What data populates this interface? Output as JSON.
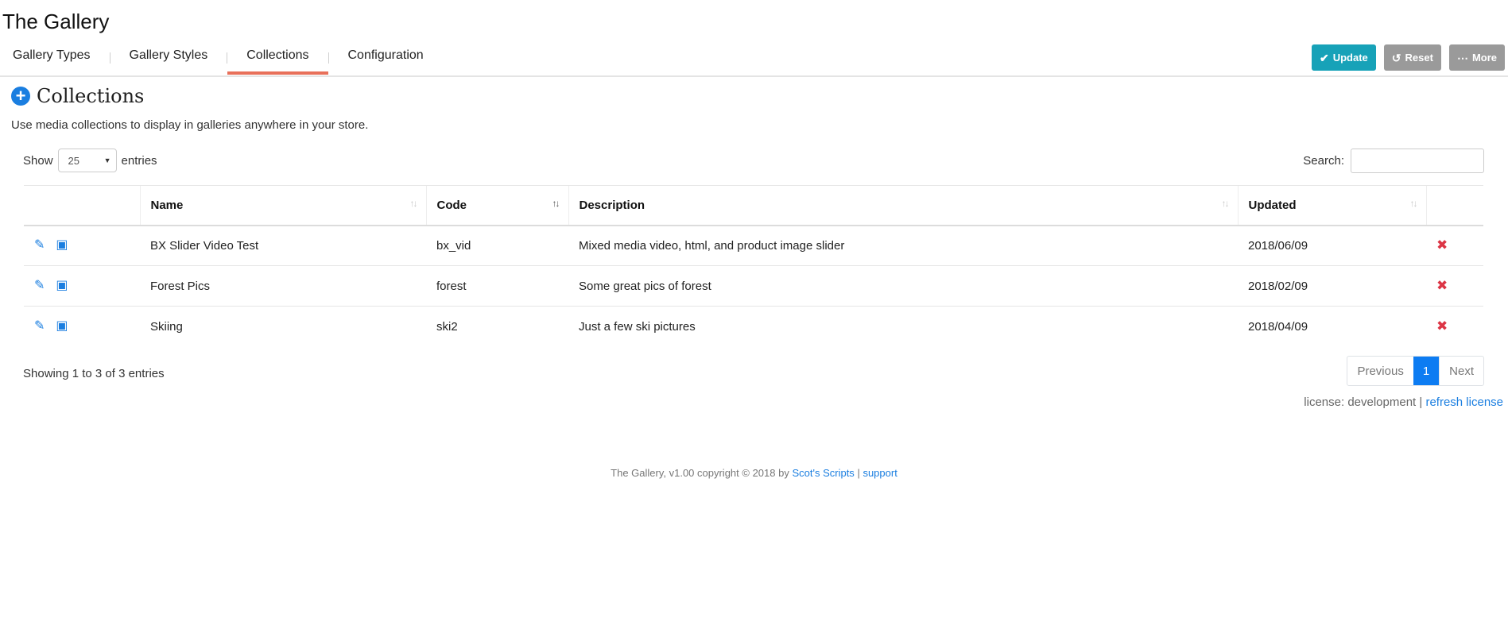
{
  "app": {
    "title": "The Gallery"
  },
  "nav": {
    "tabs": [
      {
        "label": "Gallery Types"
      },
      {
        "label": "Gallery Styles"
      },
      {
        "label": "Collections"
      },
      {
        "label": "Configuration"
      }
    ],
    "active_tab": "Collections"
  },
  "toolbar": {
    "update_label": "Update",
    "reset_label": "Reset",
    "more_label": "More"
  },
  "section": {
    "title": "Collections",
    "description": "Use media collections to display in galleries anywhere in your store."
  },
  "table_controls": {
    "show_label": "Show",
    "entries_label": "entries",
    "page_length": "25",
    "search_label": "Search:",
    "search_value": ""
  },
  "table": {
    "columns": [
      "Name",
      "Code",
      "Description",
      "Updated"
    ],
    "rows": [
      {
        "name": "BX Slider Video Test",
        "code": "bx_vid",
        "description": "Mixed media video, html, and product image slider",
        "updated": "2018/06/09"
      },
      {
        "name": "Forest Pics",
        "code": "forest",
        "description": "Some great pics of forest",
        "updated": "2018/02/09"
      },
      {
        "name": "Skiing",
        "code": "ski2",
        "description": "Just a few ski pictures",
        "updated": "2018/04/09"
      }
    ]
  },
  "pagination": {
    "info": "Showing 1 to 3 of 3 entries",
    "previous": "Previous",
    "current": "1",
    "next": "Next"
  },
  "license": {
    "text": "license: development |",
    "link": "refresh license"
  },
  "footer": {
    "text": "The Gallery, v1.00 copyright © 2018 by",
    "author_link": "Scot's Scripts",
    "separator": "|",
    "support_link": "support"
  },
  "colors": {
    "accent": "#17a2b8",
    "active_tab_underline": "#e8705a",
    "link": "#1a7ee0",
    "delete": "#dc3545",
    "page_active": "#0d7cf2"
  }
}
